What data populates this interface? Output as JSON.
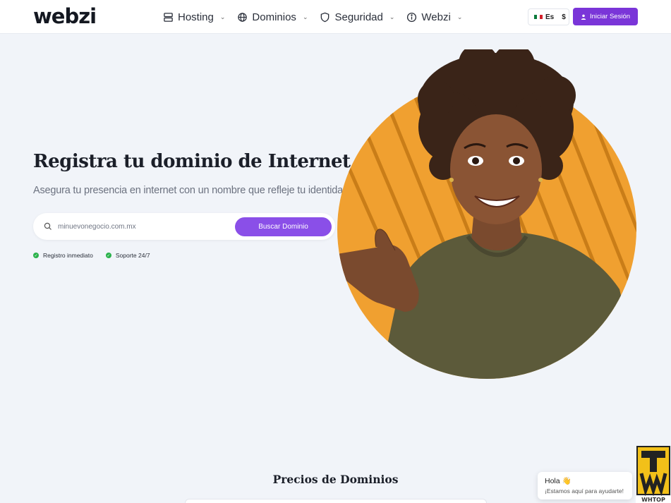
{
  "header": {
    "logo": "webzi",
    "nav": [
      {
        "label": "Hosting",
        "icon": "server-icon"
      },
      {
        "label": "Dominios",
        "icon": "globe-icon"
      },
      {
        "label": "Seguridad",
        "icon": "shield-icon"
      },
      {
        "label": "Webzi",
        "icon": "info-icon"
      }
    ],
    "language": "Es",
    "currency": "$",
    "login_label": "Iniciar Sesión"
  },
  "hero": {
    "title": "Registra tu dominio de Internet",
    "subtitle": "Asegura tu presencia en internet con un nombre que refleje tu identidad",
    "search": {
      "placeholder": "minuevonegocio.com.mx",
      "button_label": "Buscar Dominio"
    },
    "features": [
      "Registro inmediato",
      "Soporte 24/7"
    ]
  },
  "pricing": {
    "title": "Precios de Dominios"
  },
  "chat": {
    "greeting": "Hola 👋",
    "message": "¡Estamos aquí para ayudarte!"
  },
  "colors": {
    "primary": "#7a35d8",
    "button": "#8a4fe8",
    "check": "#2bb24c",
    "hero_circle": "#f0a030",
    "background": "#f1f4f9"
  }
}
